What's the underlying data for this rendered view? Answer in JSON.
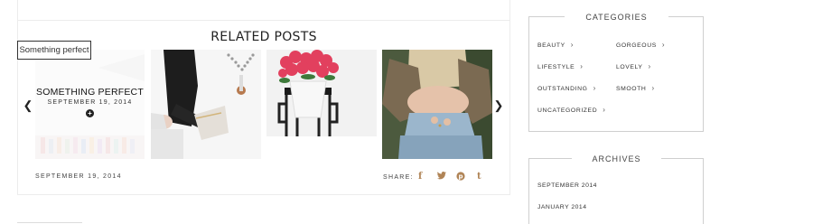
{
  "related": {
    "heading": "RELATED POSTS",
    "tooltip": "Something perfect",
    "prev_icon": "chevron-left",
    "next_icon": "chevron-right",
    "items": [
      {
        "title": "SOMETHING PERFECT",
        "date": "SEPTEMBER 19, 2014",
        "hovered": true
      },
      {
        "title": "",
        "date": ""
      },
      {
        "title": "",
        "date": ""
      },
      {
        "title": "",
        "date": ""
      }
    ]
  },
  "post_meta": {
    "date": "SEPTEMBER 19, 2014",
    "share_label": "SHARE:",
    "share_icons": [
      "facebook-icon",
      "twitter-icon",
      "pinterest-icon",
      "tumblr-icon"
    ],
    "accent": "#b08456"
  },
  "sidebar": {
    "categories": {
      "title": "CATEGORIES",
      "items": [
        "BEAUTY",
        "GORGEOUS",
        "LIFESTYLE",
        "LOVELY",
        "OUTSTANDING",
        "SMOOTH",
        "UNCATEGORIZED"
      ]
    },
    "archives": {
      "title": "ARCHIVES",
      "items": [
        "SEPTEMBER 2014",
        "JANUARY 2014"
      ]
    }
  }
}
